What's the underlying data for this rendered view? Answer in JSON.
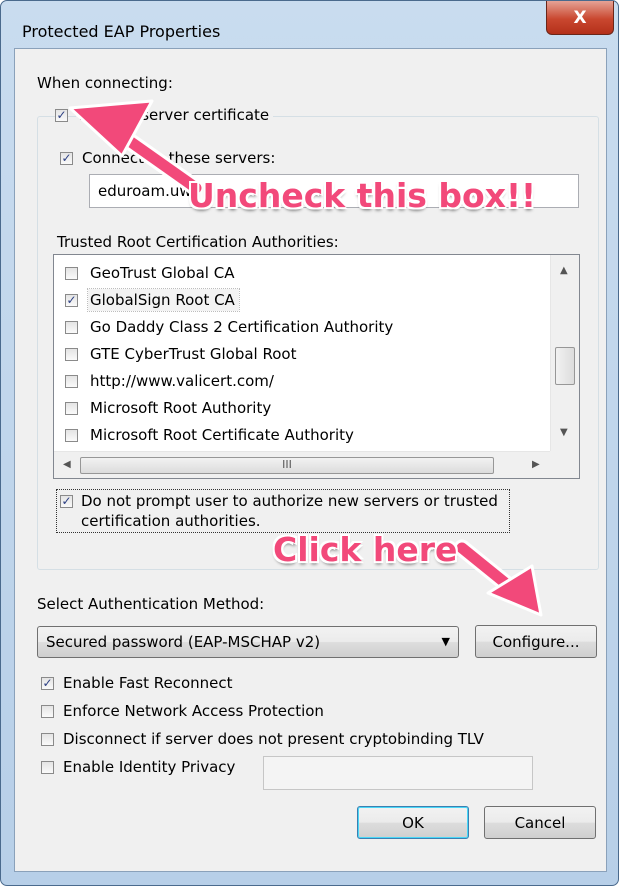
{
  "window": {
    "title": "Protected EAP Properties",
    "close_glyph": "X"
  },
  "when_connecting_label": "When connecting:",
  "validate_cert": {
    "label": "Validate server certificate",
    "checked": true
  },
  "connect_to_servers": {
    "label": "Connect to these servers:",
    "checked": true,
    "value": "eduroam.uw"
  },
  "trusted_root_label": "Trusted Root Certification Authorities:",
  "ca_list": [
    {
      "label": "GeoTrust Global CA",
      "checked": false
    },
    {
      "label": "GlobalSign Root CA",
      "checked": true
    },
    {
      "label": "Go Daddy Class 2 Certification Authority",
      "checked": false
    },
    {
      "label": "GTE CyberTrust Global Root",
      "checked": false
    },
    {
      "label": "http://www.valicert.com/",
      "checked": false
    },
    {
      "label": "Microsoft Root Authority",
      "checked": false
    },
    {
      "label": "Microsoft Root Certificate Authority",
      "checked": false
    }
  ],
  "scrollbar": {
    "h_thumb_grip": "III"
  },
  "do_not_prompt": {
    "line1": "Do not prompt user to authorize new servers or trusted",
    "line2": "certification authorities.",
    "checked": true
  },
  "auth_method_label": "Select Authentication Method:",
  "auth_method": {
    "selected": "Secured password (EAP-MSCHAP v2)"
  },
  "configure_label": "Configure...",
  "options": [
    {
      "label": "Enable Fast Reconnect",
      "checked": true
    },
    {
      "label": "Enforce Network Access Protection",
      "checked": false
    },
    {
      "label": "Disconnect if server does not present cryptobinding TLV",
      "checked": false
    },
    {
      "label": "Enable Identity Privacy",
      "checked": false
    }
  ],
  "identity_value": "",
  "ok_label": "OK",
  "cancel_label": "Cancel",
  "annotations": {
    "uncheck": "Uncheck this box!!",
    "click_here": "Click here",
    "color": "#f2497a"
  }
}
